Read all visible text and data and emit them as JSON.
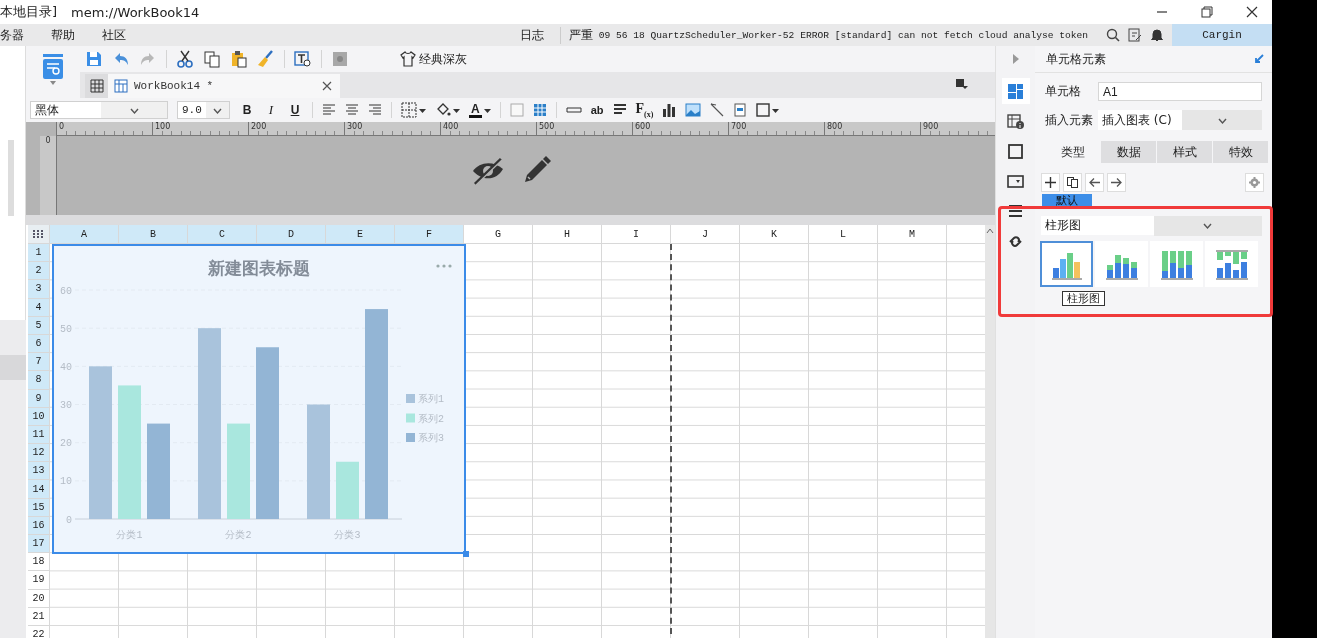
{
  "window": {
    "title": "本地目录]",
    "path": "mem://WorkBook14"
  },
  "menu": [
    {
      "label": "务器"
    },
    {
      "label": "帮助"
    },
    {
      "label": "社区"
    }
  ],
  "log": {
    "label": "日志",
    "severity": "严重",
    "message": "09 56 18 QuartzScheduler_Worker-52 ERROR [standard] can not fetch cloud analyse token"
  },
  "user": "Cargin",
  "toolbar": {
    "theme_button": "经典深灰"
  },
  "tabs": [
    {
      "label": "WorkBook14 *",
      "selected": true
    }
  ],
  "format": {
    "font": "黑体",
    "size": "9.0",
    "bold": "B",
    "italic": "I",
    "underline": "U",
    "font_color": "A",
    "wrap": "ab",
    "formula": "F$_{(x)}$"
  },
  "ruler": {
    "marks": [
      "0",
      "100",
      "200",
      "300",
      "400",
      "500",
      "600",
      "700",
      "800",
      "900"
    ],
    "vertical": "0"
  },
  "sheet": {
    "columns": [
      {
        "label": "A",
        "selected": true,
        "page_break": false
      },
      {
        "label": "B",
        "selected": true,
        "page_break": false
      },
      {
        "label": "C",
        "selected": true,
        "page_break": false
      },
      {
        "label": "D",
        "selected": true,
        "page_break": false
      },
      {
        "label": "E",
        "selected": true,
        "page_break": false
      },
      {
        "label": "F",
        "selected": true,
        "page_break": false
      },
      {
        "label": "G",
        "selected": false,
        "page_break": false
      },
      {
        "label": "H",
        "selected": false,
        "page_break": false
      },
      {
        "label": "I",
        "selected": false,
        "page_break": true
      },
      {
        "label": "J",
        "selected": false,
        "page_break": false
      },
      {
        "label": "K",
        "selected": false,
        "page_break": false
      },
      {
        "label": "L",
        "selected": false,
        "page_break": false
      },
      {
        "label": "M",
        "selected": false,
        "page_break": false
      }
    ],
    "rows": [
      {
        "label": "1",
        "selected": true
      },
      {
        "label": "2",
        "selected": true
      },
      {
        "label": "3",
        "selected": true
      },
      {
        "label": "4",
        "selected": true
      },
      {
        "label": "5",
        "selected": true
      },
      {
        "label": "6",
        "selected": true
      },
      {
        "label": "7",
        "selected": true
      },
      {
        "label": "8",
        "selected": true
      },
      {
        "label": "9",
        "selected": true
      },
      {
        "label": "10",
        "selected": true
      },
      {
        "label": "11",
        "selected": true
      },
      {
        "label": "12",
        "selected": true
      },
      {
        "label": "13",
        "selected": true
      },
      {
        "label": "14",
        "selected": true
      },
      {
        "label": "15",
        "selected": true
      },
      {
        "label": "16",
        "selected": true
      },
      {
        "label": "17",
        "selected": true
      },
      {
        "label": "18",
        "selected": false
      },
      {
        "label": "19",
        "selected": false
      },
      {
        "label": "20",
        "selected": false
      },
      {
        "label": "21",
        "selected": false
      },
      {
        "label": "22",
        "selected": false
      }
    ]
  },
  "chart": {
    "chart_data": {
      "type": "bar",
      "title": "新建图表标题",
      "categories": [
        "分类1",
        "分类2",
        "分类3"
      ],
      "series": [
        {
          "name": "系列1",
          "color": "#a9c3dc",
          "values": [
            40,
            50,
            30
          ]
        },
        {
          "name": "系列2",
          "color": "#a9e7de",
          "values": [
            35,
            25,
            15
          ]
        },
        {
          "name": "系列3",
          "color": "#93b5d5",
          "values": [
            25,
            45,
            55
          ]
        }
      ],
      "ylim": [
        0,
        60
      ],
      "yticks": [
        {
          "value": 0,
          "label": "0"
        },
        {
          "value": 10,
          "label": "10"
        },
        {
          "value": 20,
          "label": "20"
        },
        {
          "value": 30,
          "label": "30"
        },
        {
          "value": 40,
          "label": "40"
        },
        {
          "value": 50,
          "label": "50"
        },
        {
          "value": 60,
          "label": "60"
        }
      ],
      "grid": true,
      "legend": true
    }
  },
  "side_tools": [
    {
      "kind": "layout",
      "selected": true
    },
    {
      "kind": "cell-info",
      "selected": false
    },
    {
      "kind": "square",
      "selected": false
    },
    {
      "kind": "frame",
      "selected": false
    },
    {
      "kind": "list",
      "selected": false
    },
    {
      "kind": "link",
      "selected": false
    }
  ],
  "panel": {
    "title": "单元格元素",
    "cell_label": "单元格",
    "cell_value": "A1",
    "insert_label": "插入元素",
    "insert_value": "插入图表 (C)",
    "tabs": [
      {
        "label": "类型",
        "selected": true
      },
      {
        "label": "数据",
        "selected": false
      },
      {
        "label": "样式",
        "selected": false
      },
      {
        "label": "特效",
        "selected": false
      }
    ],
    "tag": "默认",
    "chart_select": "柱形图",
    "chart_types": [
      {
        "kind": "clustered",
        "selected": true
      },
      {
        "kind": "stacked",
        "selected": false
      },
      {
        "kind": "percent",
        "selected": false
      },
      {
        "kind": "range",
        "selected": false
      }
    ],
    "tooltip": "柱形图"
  }
}
